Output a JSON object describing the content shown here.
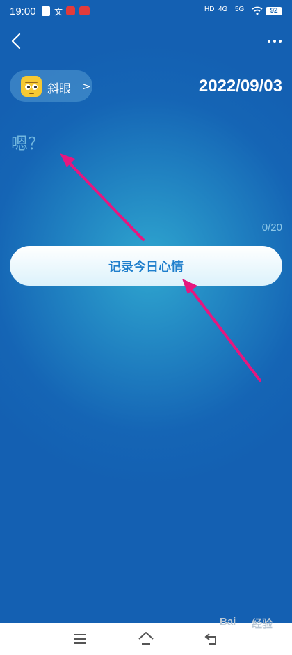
{
  "status_bar": {
    "time": "19:00",
    "app_icons": [
      "flag-icon",
      "text-icon",
      "red-app-icon",
      "red-app-icon-2"
    ],
    "wen_glyph": "文",
    "signal_1": "4G",
    "signal_2": "5G",
    "hd": "HD",
    "battery": "92"
  },
  "toolbar": {
    "back_icon": "chevron-left-icon",
    "more_icon": "more-dots-icon"
  },
  "mood": {
    "emoji_icon": "squint-face-icon",
    "label": "斜眼",
    "chevron": ">"
  },
  "date": "2022/09/03",
  "entry": {
    "placeholder": "嗯？",
    "value": "",
    "counter": "0/20"
  },
  "record_button": {
    "label": "记录今日心情"
  },
  "annotation_color": "#e6177f",
  "nav_bar": {
    "items": [
      "menu-icon",
      "home-icon",
      "back-icon"
    ]
  },
  "watermark": {
    "text": "Bai",
    "brand_text": "经验"
  },
  "colors": {
    "background": "#1a72bb",
    "accent": "#1f7fcc",
    "chip": "#6db6e0",
    "emoji": "#f7c932"
  }
}
